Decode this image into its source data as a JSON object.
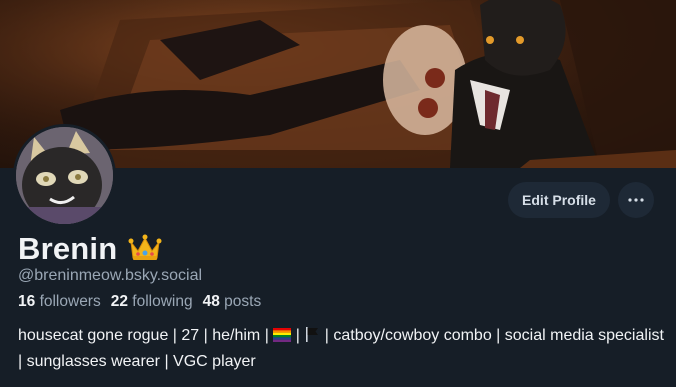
{
  "profile": {
    "display_name": "Brenin",
    "crown_icon": "crown-emoji",
    "handle": "@breninmeow.bsky.social",
    "edit_label": "Edit Profile",
    "more_icon": "ellipsis-icon"
  },
  "stats": {
    "followers_count": "16",
    "followers_label": "followers",
    "following_count": "22",
    "following_label": "following",
    "posts_count": "48",
    "posts_label": "posts"
  },
  "bio": {
    "part1": "housecat gone rogue | 27 | he/him | ",
    "flag1_icon": "rainbow-flag-emoji",
    "part2": " | ",
    "flag2_icon": "black-flag-emoji",
    "part3": " | catboy/cowboy combo | social media specialist | sunglasses wearer | VGC player"
  },
  "colors": {
    "background": "#161e27",
    "button": "#1e2936",
    "muted_text": "#9aa7b5",
    "text": "#f1f3f5"
  }
}
